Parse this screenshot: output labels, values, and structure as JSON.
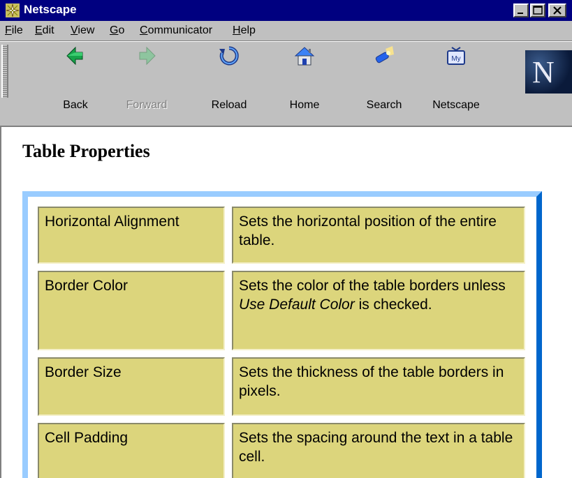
{
  "window": {
    "title": "Netscape"
  },
  "menu": [
    "File",
    "Edit",
    "View",
    "Go",
    "Communicator",
    "Help"
  ],
  "toolbar": {
    "buttons": [
      {
        "label": "Back",
        "icon": "back-arrow-icon",
        "enabled": true
      },
      {
        "label": "Forward",
        "icon": "forward-arrow-icon",
        "enabled": false
      },
      {
        "label": "Reload",
        "icon": "reload-icon",
        "enabled": true
      },
      {
        "label": "Home",
        "icon": "home-icon",
        "enabled": true
      },
      {
        "label": "Search",
        "icon": "search-flashlight-icon",
        "enabled": true
      },
      {
        "label": "Netscape",
        "icon": "my-netscape-icon",
        "enabled": true
      }
    ],
    "logo": "N"
  },
  "page": {
    "heading": "Table Properties",
    "rows": [
      {
        "property": "Horizontal Alignment",
        "description": "Sets the horizontal position of the entire table."
      },
      {
        "property": "Border Color",
        "description_before": "Sets the color of the table borders unless ",
        "description_italic": "Use Default Color",
        "description_after": " is checked."
      },
      {
        "property": "Border Size",
        "description": "Sets the thickness of the table borders in pixels."
      },
      {
        "property": "Cell Padding",
        "description": "Sets the spacing around the text in a table cell."
      }
    ]
  },
  "colors": {
    "titlebar": "#000080",
    "chrome": "#c0c0c0",
    "cell_fill": "#dcd57c",
    "frame_light": "#99ccff",
    "frame_dark": "#0066cc"
  }
}
